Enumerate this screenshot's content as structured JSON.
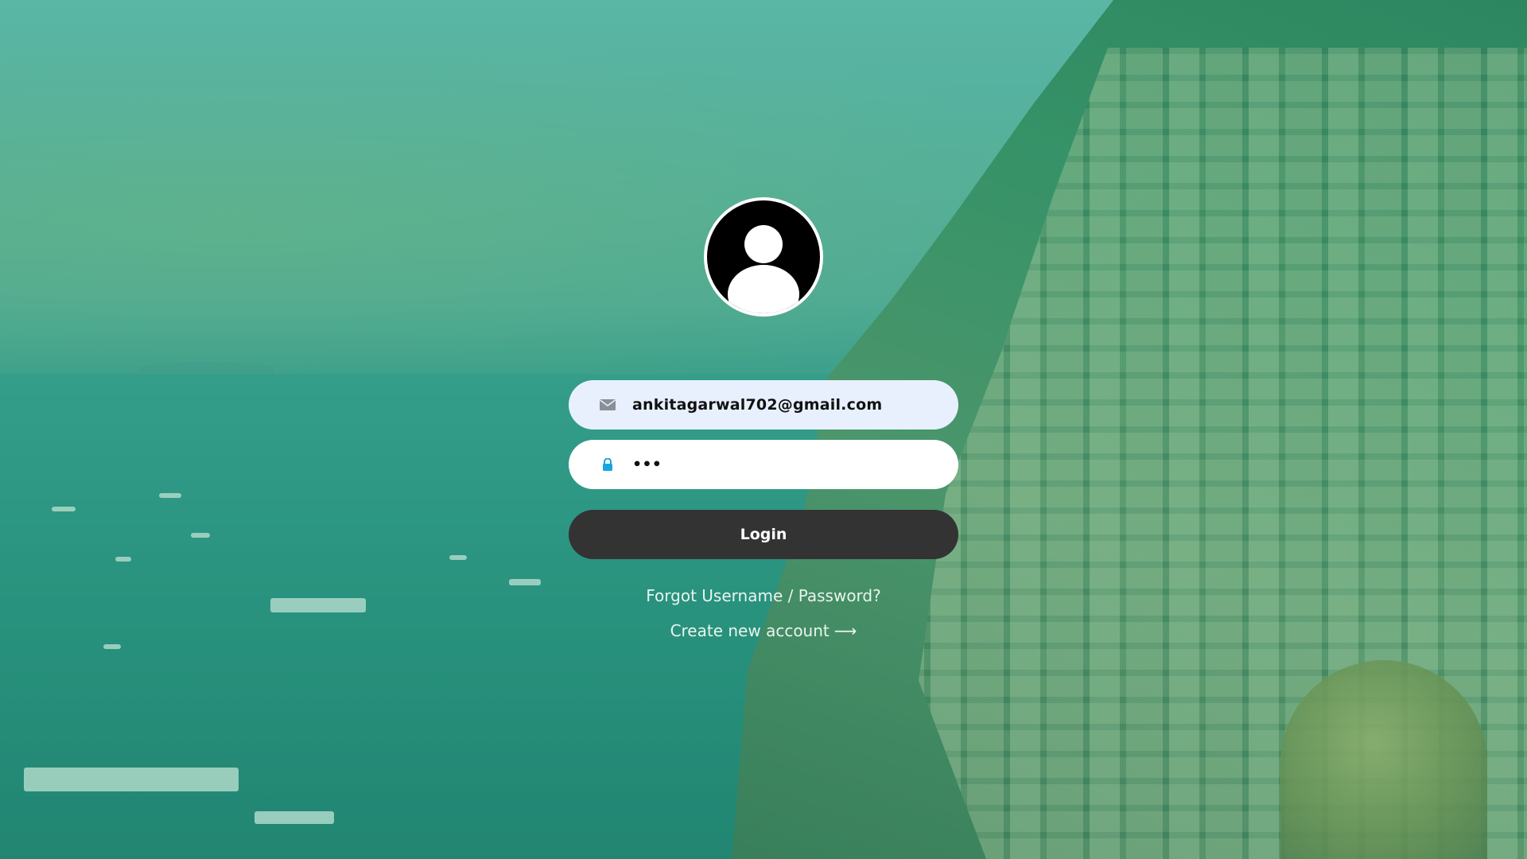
{
  "login_form": {
    "email": {
      "value": "ankitagarwal702@gmail.com",
      "icon": "envelope-icon"
    },
    "password": {
      "value": "•••",
      "icon": "lock-icon"
    },
    "login_label": "Login",
    "forgot_label": "Forgot Username / Password?",
    "create_label": "Create new account",
    "create_arrow": "⟶"
  },
  "avatar": {
    "icon": "user-avatar-icon"
  },
  "colors": {
    "button": "#333333",
    "email_field": "#e8f0fe",
    "password_field": "#ffffff",
    "lock": "#1aa3e0",
    "envelope": "#8a8f98",
    "overlay": "#28aa8c"
  }
}
